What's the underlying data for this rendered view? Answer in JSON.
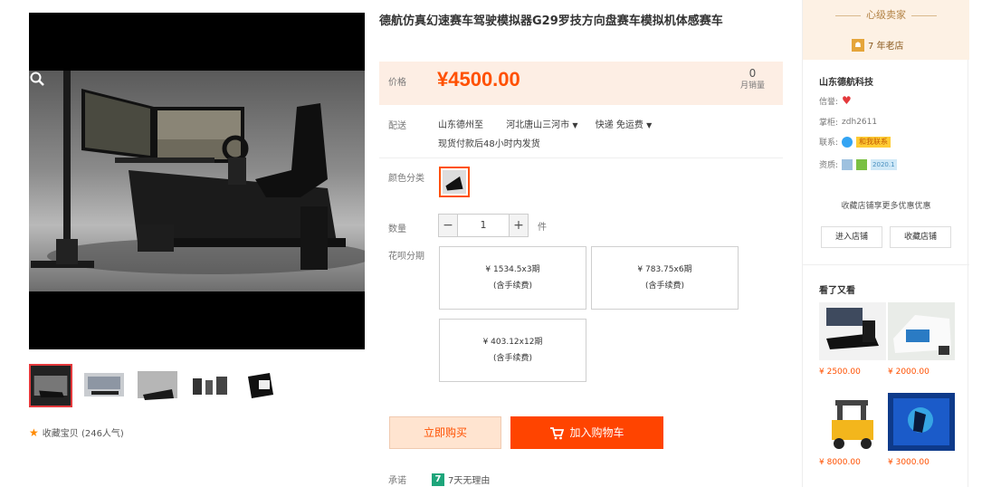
{
  "product": {
    "title": "德航仿真幻速赛车驾驶模拟器G29罗技方向盘赛车模拟机体感赛车",
    "price_label": "价格",
    "price": "¥4500.00",
    "review_count": "0",
    "review_label": "月销量"
  },
  "shipping": {
    "label": "配送",
    "from": "山东德州至",
    "to": "河北唐山三河市",
    "express": "快递 免运费",
    "note": "现货付款后48小时内发货"
  },
  "color": {
    "label": "颜色分类"
  },
  "quantity": {
    "label": "数量",
    "minus": "−",
    "value": "1",
    "plus": "+",
    "unit": "件"
  },
  "installment": {
    "label": "花呗分期",
    "plans": [
      {
        "amount": "¥ 1534.5x3期",
        "fee": "(含手续费)"
      },
      {
        "amount": "¥ 783.75x6期",
        "fee": "(含手续费)"
      },
      {
        "amount": "¥ 403.12x12期",
        "fee": "(含手续费)"
      }
    ]
  },
  "actions": {
    "buy_now": "立即购买",
    "add_cart": "加入购物车"
  },
  "promise": {
    "label": "承诺",
    "badge": "7",
    "text": "7天无理由"
  },
  "favorite": {
    "text": "收藏宝贝 (246人气)"
  },
  "store": {
    "tag": "心级卖家",
    "years": "7 年老店",
    "name": "山东德航科技",
    "reputation_label": "信誉:",
    "seller_label": "掌柜:",
    "seller": "zdh2611",
    "contact_label": "联系:",
    "contact_badge": "和我联系",
    "qualification_label": "资质:",
    "qualification_badge": "2020.1",
    "collect_promo": "收藏店铺享更多优惠优惠",
    "enter_store": "进入店铺",
    "collect_store": "收藏店铺"
  },
  "seen": {
    "title": "看了又看",
    "items": [
      {
        "price": "¥ 2500.00"
      },
      {
        "price": "¥ 2000.00"
      },
      {
        "price": "¥ 8000.00"
      },
      {
        "price": "¥ 3000.00"
      }
    ]
  },
  "colors": {
    "accent": "#ff5000",
    "price_bg": "#fdeee4",
    "store_head_bg": "#fdf1e4"
  }
}
